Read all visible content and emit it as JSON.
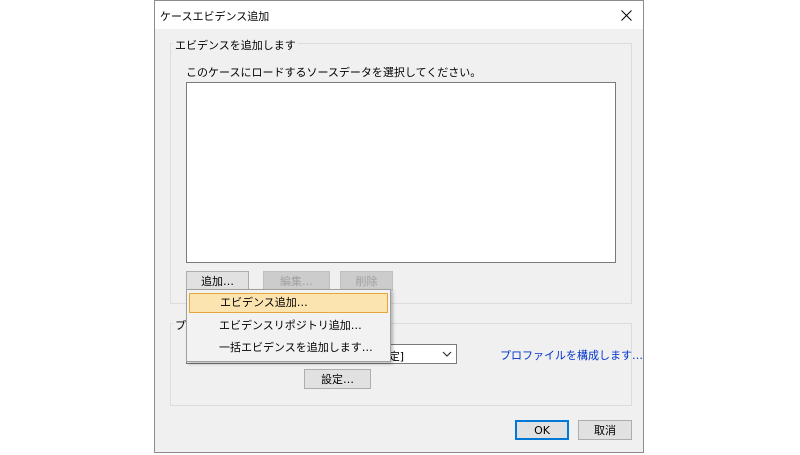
{
  "dialog": {
    "title": "ケースエビデンス追加",
    "ok_label": "OK",
    "cancel_label": "取消"
  },
  "evidence_group": {
    "label": "エビデンスを追加します",
    "instruction": "このケースにロードするソースデータを選択してください。",
    "add_label": "追加…",
    "edit_label": "編集…",
    "delete_label": "削除"
  },
  "profile_group": {
    "label_visible": "プ",
    "combo_visible_text": "定]",
    "configure_link": "プロファイルを構成します…",
    "settings_label": "設定…"
  },
  "add_menu": {
    "items": [
      {
        "label": "エビデンス追加…",
        "highlighted": true
      },
      {
        "label": "エビデンスリポジトリ追加…",
        "highlighted": false
      },
      {
        "label": "一括エビデンスを追加します…",
        "highlighted": false
      }
    ]
  },
  "icons": {
    "close": "close-icon",
    "dropdown": "chevron-down-icon"
  }
}
